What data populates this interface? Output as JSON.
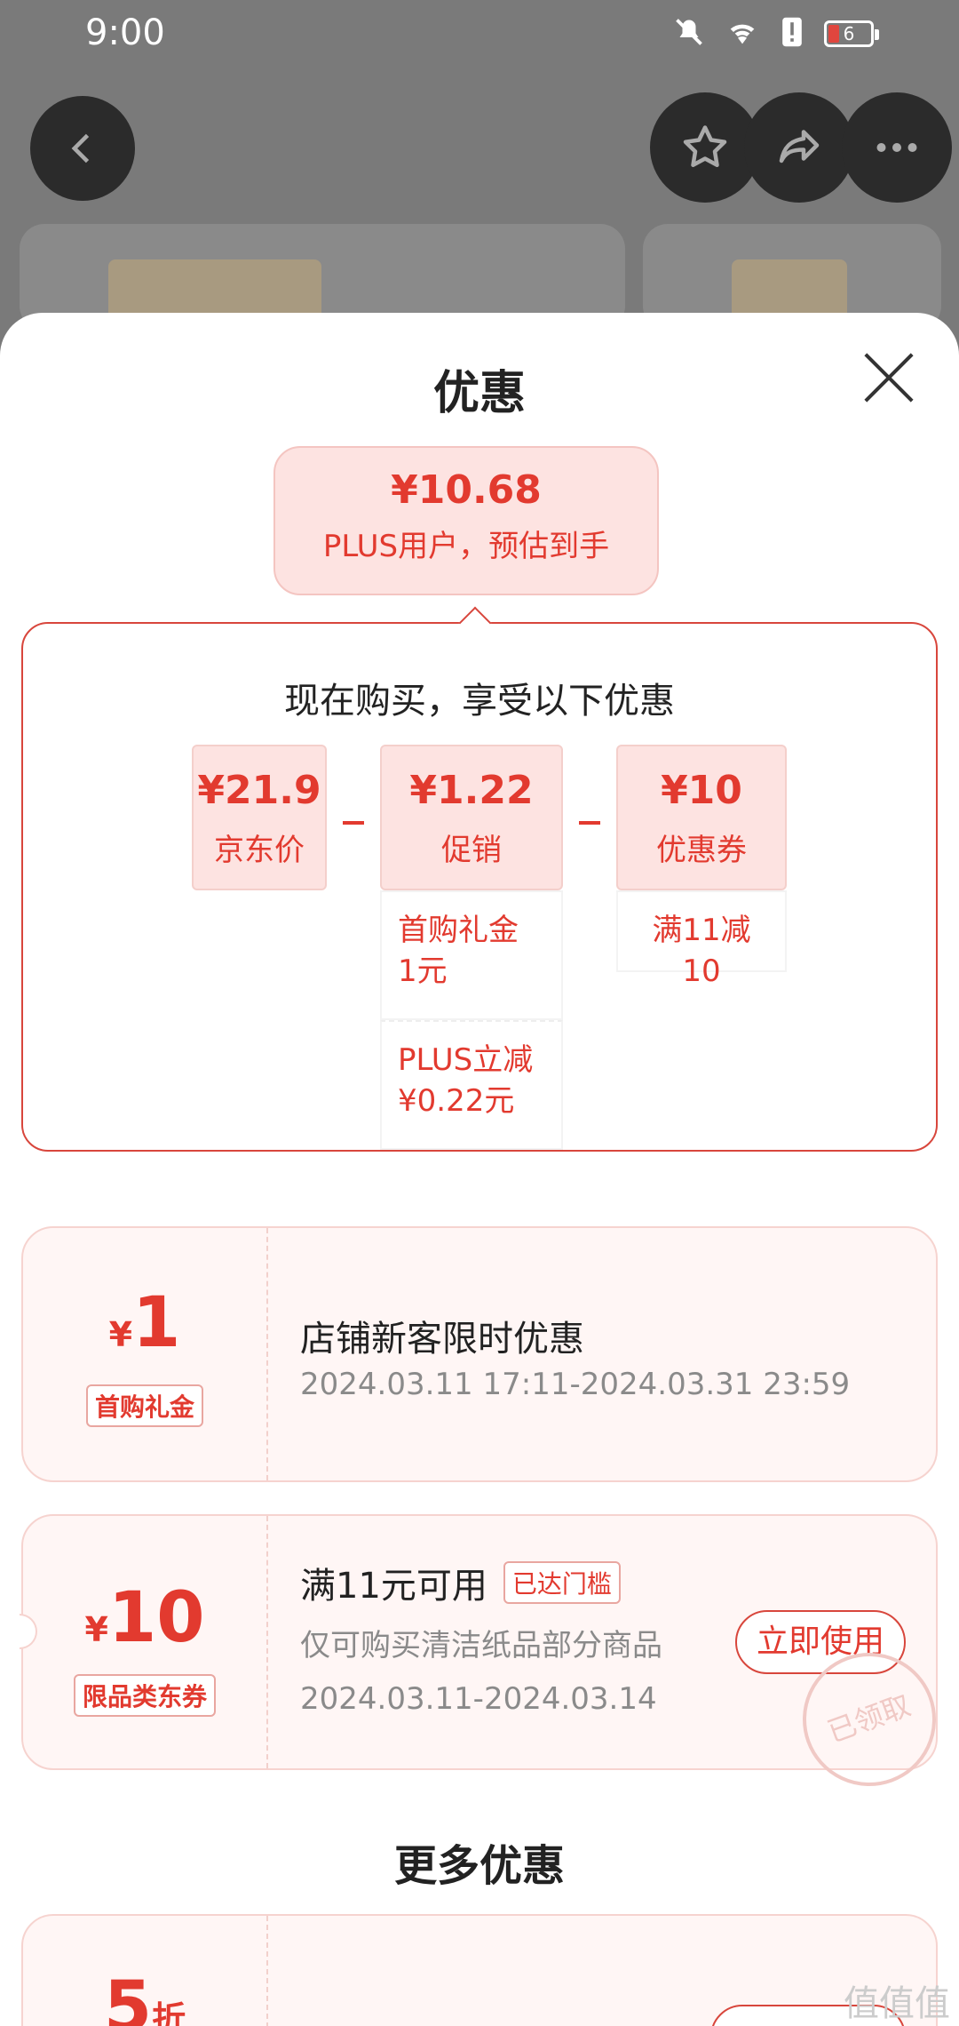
{
  "status": {
    "time": "9:00",
    "battery": "6"
  },
  "sheet": {
    "title": "优惠",
    "estimate": {
      "price": "¥10.68",
      "label": "PLUS用户，预估到手"
    },
    "breakdown": {
      "title": "现在购买，享受以下优惠",
      "items": [
        {
          "value": "¥21.9",
          "label": "京东价"
        },
        {
          "value": "¥1.22",
          "label": "促销",
          "details": [
            "首购礼金\n1元",
            "PLUS立减\n¥0.22元"
          ]
        },
        {
          "value": "¥10",
          "label": "优惠券",
          "details": [
            "满11减10"
          ]
        }
      ],
      "operator": "-"
    }
  },
  "coupons": [
    {
      "currency": "¥",
      "amount": "1",
      "tag": "首购礼金",
      "title": "店铺新客限时优惠",
      "period": "2024.03.11 17:11-2024.03.31 23:59"
    },
    {
      "currency": "¥",
      "amount": "10",
      "tag": "限品类东券",
      "title": "满11元可用",
      "badge": "已达门槛",
      "desc": "仅可购买清洁纸品部分商品",
      "period": "2024.03.11-2024.03.14",
      "button": "立即使用",
      "stamp": "已领取"
    }
  ],
  "more": {
    "title": "更多优惠",
    "first_amount": "5",
    "first_unit": "折"
  },
  "watermark": "值值值"
}
